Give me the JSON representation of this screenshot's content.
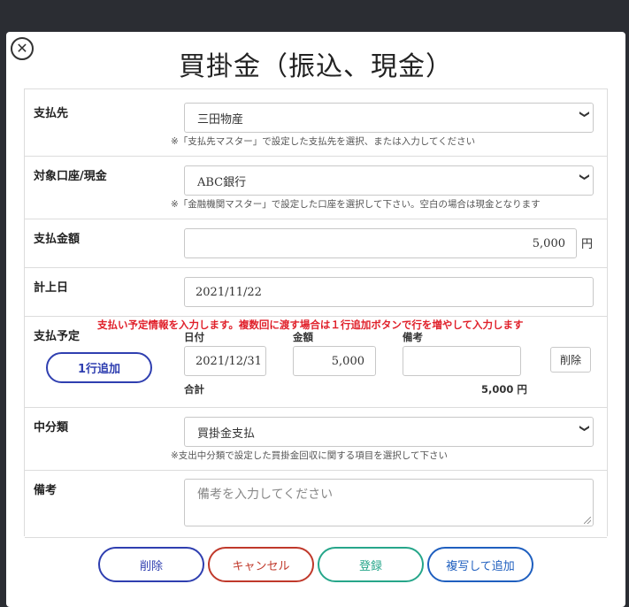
{
  "title": "買掛金（振込、現金）",
  "fields": {
    "payee": {
      "label": "支払先",
      "value": "三田物産",
      "hint": "※「支払先マスター」で設定した支払先を選択、または入力してください"
    },
    "account": {
      "label": "対象口座/現金",
      "value": "ABC銀行",
      "hint": "※「金融機関マスター」で設定した口座を選択して下さい。空白の場合は現金となります"
    },
    "amount": {
      "label": "支払金額",
      "value": "5,000",
      "unit": "円"
    },
    "date": {
      "label": "計上日",
      "value": "2021/11/22"
    },
    "schedule": {
      "label": "支払予定",
      "notice": "支払い予定情報を入力します。複数回に渡す場合は１行追加ボタンで行を増やして入力します",
      "add_row": "1行追加",
      "col_date": "日付",
      "col_amount": "金額",
      "col_note": "備考",
      "row_date": "2021/12/31",
      "row_amount": "5,000",
      "row_note": "",
      "delete_row": "削除",
      "total_label": "合計",
      "total_value": "5,000 円"
    },
    "category": {
      "label": "中分類",
      "value": "買掛金支払",
      "hint": "※支出中分類で設定した買掛金回収に関する項目を選択して下さい"
    },
    "note": {
      "label": "備考",
      "placeholder": "備考を入力してください"
    }
  },
  "buttons": {
    "delete": "削除",
    "cancel": "キャンセル",
    "register": "登録",
    "copy_add": "複写して追加"
  },
  "colors": {
    "delete": "#2f3fb0",
    "cancel": "#c0392b",
    "register": "#26a68a",
    "copy_add": "#1f5fbf",
    "notice": "#e0202a"
  }
}
